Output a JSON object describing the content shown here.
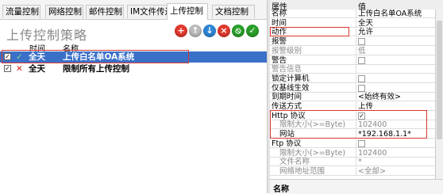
{
  "tabs": [
    "流量控制",
    "网络控制",
    "邮件控制",
    "IM文件传送",
    "上传控制",
    "文档控制"
  ],
  "active_tab": "上传控制",
  "panel_title": "上传控制策略",
  "toolbar": {
    "add_icon": "plus-icon",
    "up_icon": "arrow-up-icon",
    "down_icon": "arrow-down-icon",
    "delete_icon": "x-icon",
    "disable_icon": "no-icon",
    "enable_icon": "check-icon"
  },
  "grid": {
    "columns": {
      "time": "时间",
      "name": "名称"
    },
    "rows": [
      {
        "checked": true,
        "allow": true,
        "time": "全天",
        "name": "上传白名单OA系统",
        "selected": true
      },
      {
        "checked": true,
        "allow": false,
        "time": "全天",
        "name": "限制所有上传控制",
        "selected": false
      }
    ]
  },
  "props": {
    "headers": {
      "key": "属性",
      "value": "值"
    },
    "rows": [
      {
        "k": "名称",
        "v": "上传白名单OA系统"
      },
      {
        "k": "时间",
        "v": "全天"
      },
      {
        "k": "动作",
        "v": "允许"
      },
      {
        "k": "报警",
        "checkbox": false
      },
      {
        "k": "报警级别",
        "v": "低",
        "grey": true
      },
      {
        "k": "警告",
        "checkbox": false
      },
      {
        "k": "警告信息",
        "v": "",
        "grey": true
      },
      {
        "k": "锁定计算机",
        "checkbox": false
      },
      {
        "k": "仅基线生效",
        "checkbox": false
      },
      {
        "k": "到期时间",
        "v": "<始终有效>"
      },
      {
        "k": "传送方式",
        "v": "上传"
      },
      {
        "k": "Http 协议",
        "checkbox": true
      },
      {
        "k": "限制大小(>=Byte)",
        "v": "102400",
        "grey": true,
        "indent": true
      },
      {
        "k": "网站",
        "v": "*192.168.1.1*",
        "indent": true
      },
      {
        "k": "Ftp 协议",
        "checkbox": false
      },
      {
        "k": "限制大小(>=Byte)",
        "v": "102400",
        "grey": true,
        "indent": true
      },
      {
        "k": "文件名称",
        "v": "*",
        "grey": true,
        "indent": true
      },
      {
        "k": "网络地址范围",
        "v": "<全部>",
        "grey": true,
        "indent": true
      }
    ],
    "footer_label": "名称"
  },
  "colors": {
    "selection": "#3a70c8",
    "highlight": "#d9382e",
    "allow": "#2aa02a",
    "deny": "#d02020"
  }
}
